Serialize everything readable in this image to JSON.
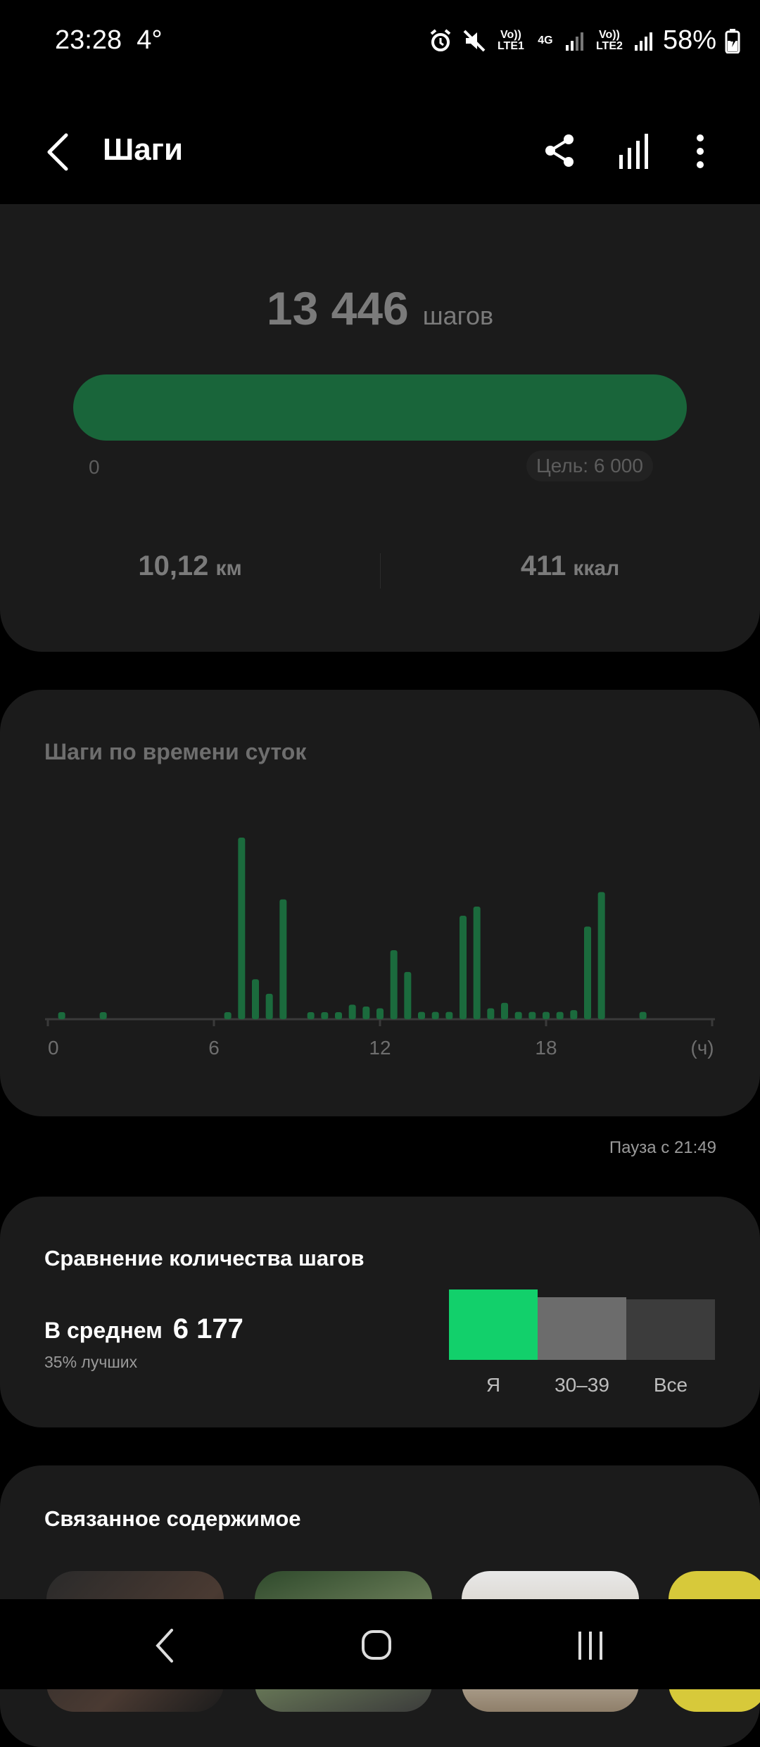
{
  "status": {
    "time": "23:28",
    "temp": "4°",
    "sim1": "Vo)) LTE1",
    "net": "4G",
    "sim2": "Vo)) LTE2",
    "battery": "58%"
  },
  "header": {
    "title": "Шаги"
  },
  "summary": {
    "steps_value": "13 446",
    "steps_unit": "шагов",
    "progress_fraction": 1.0,
    "zero_label": "0",
    "goal_label": "Цель: 6 000",
    "distance_value": "10,12",
    "distance_unit": "км",
    "calories_value": "411",
    "calories_unit": "ккал"
  },
  "hourly": {
    "title": "Шаги по времени суток",
    "pause_text": "Пауза с 21:49"
  },
  "chart_data": {
    "type": "bar",
    "title": "Шаги по времени суток",
    "x_ticks": [
      "0",
      "6",
      "12",
      "18",
      "(ч)"
    ],
    "x_range": [
      0,
      24
    ],
    "y_range": [
      0,
      100
    ],
    "bars": [
      {
        "x": 0.5,
        "y": 3
      },
      {
        "x": 2.0,
        "y": 3
      },
      {
        "x": 6.5,
        "y": 3
      },
      {
        "x": 7.0,
        "y": 100
      },
      {
        "x": 7.5,
        "y": 22
      },
      {
        "x": 8.0,
        "y": 14
      },
      {
        "x": 8.5,
        "y": 66
      },
      {
        "x": 9.5,
        "y": 3
      },
      {
        "x": 10.0,
        "y": 3
      },
      {
        "x": 10.5,
        "y": 3
      },
      {
        "x": 11.0,
        "y": 8
      },
      {
        "x": 11.5,
        "y": 7
      },
      {
        "x": 12.0,
        "y": 6
      },
      {
        "x": 12.5,
        "y": 38
      },
      {
        "x": 13.0,
        "y": 26
      },
      {
        "x": 13.5,
        "y": 4
      },
      {
        "x": 14.0,
        "y": 4
      },
      {
        "x": 14.5,
        "y": 4
      },
      {
        "x": 15.0,
        "y": 57
      },
      {
        "x": 15.5,
        "y": 62
      },
      {
        "x": 16.0,
        "y": 6
      },
      {
        "x": 16.5,
        "y": 9
      },
      {
        "x": 17.0,
        "y": 4
      },
      {
        "x": 17.5,
        "y": 4
      },
      {
        "x": 18.0,
        "y": 4
      },
      {
        "x": 18.5,
        "y": 4
      },
      {
        "x": 19.0,
        "y": 5
      },
      {
        "x": 19.5,
        "y": 51
      },
      {
        "x": 20.0,
        "y": 70
      },
      {
        "x": 21.5,
        "y": 4
      }
    ],
    "bar_color": "#1b6b3d",
    "axis_color": "#3a3a3a"
  },
  "comparison": {
    "title": "Сравнение количества шагов",
    "avg_label": "В среднем",
    "avg_value": "6 177",
    "better_text": "35% лучших",
    "bars": [
      {
        "label": "Я",
        "color": "#12d06b",
        "value": 100
      },
      {
        "label": "30–39",
        "color": "#6c6c6c",
        "value": 89
      },
      {
        "label": "Все",
        "color": "#3c3c3c",
        "value": 86
      }
    ]
  },
  "related": {
    "title": "Связанное содержимое"
  },
  "colors": {
    "progress": "#19653a",
    "card_bg": "#1b1b1b"
  }
}
